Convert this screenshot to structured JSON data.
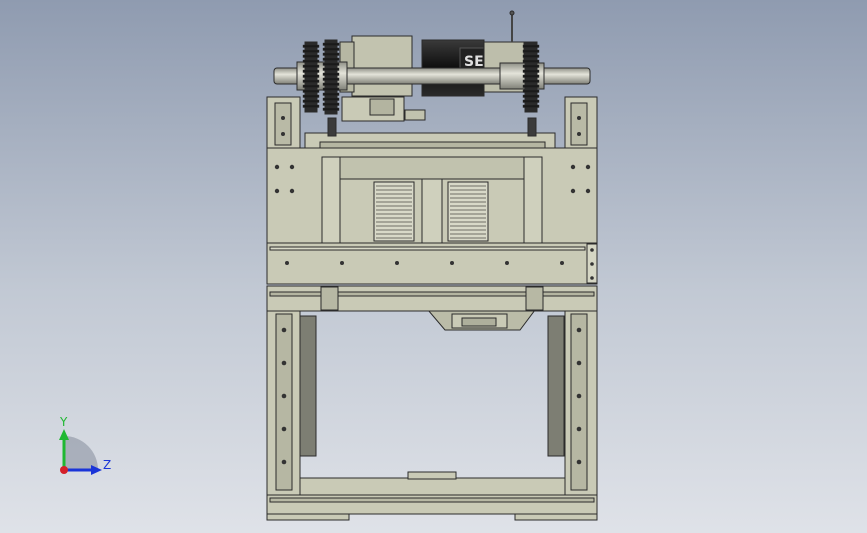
{
  "viewport": {
    "background_top": "#8f9bb0",
    "background_bottom": "#dfe2e8"
  },
  "model": {
    "frame_color": "#c9cab6",
    "edge_color": "#2b2b2b",
    "shadow_color": "#9a9b8a",
    "motor_color": "#1c1c1c",
    "motor_label": "SE"
  },
  "triad": {
    "x_color": "#d4202a",
    "y_color": "#1fb832",
    "z_color": "#1a35d8",
    "y_label": "Y",
    "z_label": "Z"
  }
}
